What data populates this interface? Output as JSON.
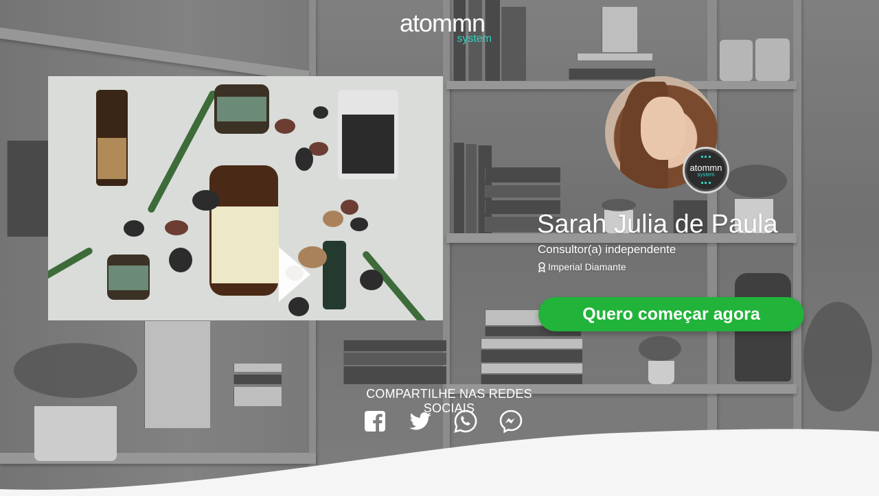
{
  "brand": {
    "logo_word": "atommn",
    "logo_sub": "system",
    "accent_color": "#2fd3c0"
  },
  "video": {
    "play_icon": "play-icon"
  },
  "profile": {
    "name": "Sarah Julia de Paula",
    "role": "Consultor(a) independente",
    "rank": "Imperial Diamante",
    "rank_icon": "award-icon",
    "badge_word": "atommn",
    "badge_sub": "system"
  },
  "cta": {
    "label": "Quero começar agora",
    "color": "#22b33b"
  },
  "share": {
    "title": "COMPARTILHE NAS REDES SOCIAIS",
    "icons": [
      "facebook-icon",
      "twitter-icon",
      "whatsapp-icon",
      "messenger-icon"
    ]
  }
}
